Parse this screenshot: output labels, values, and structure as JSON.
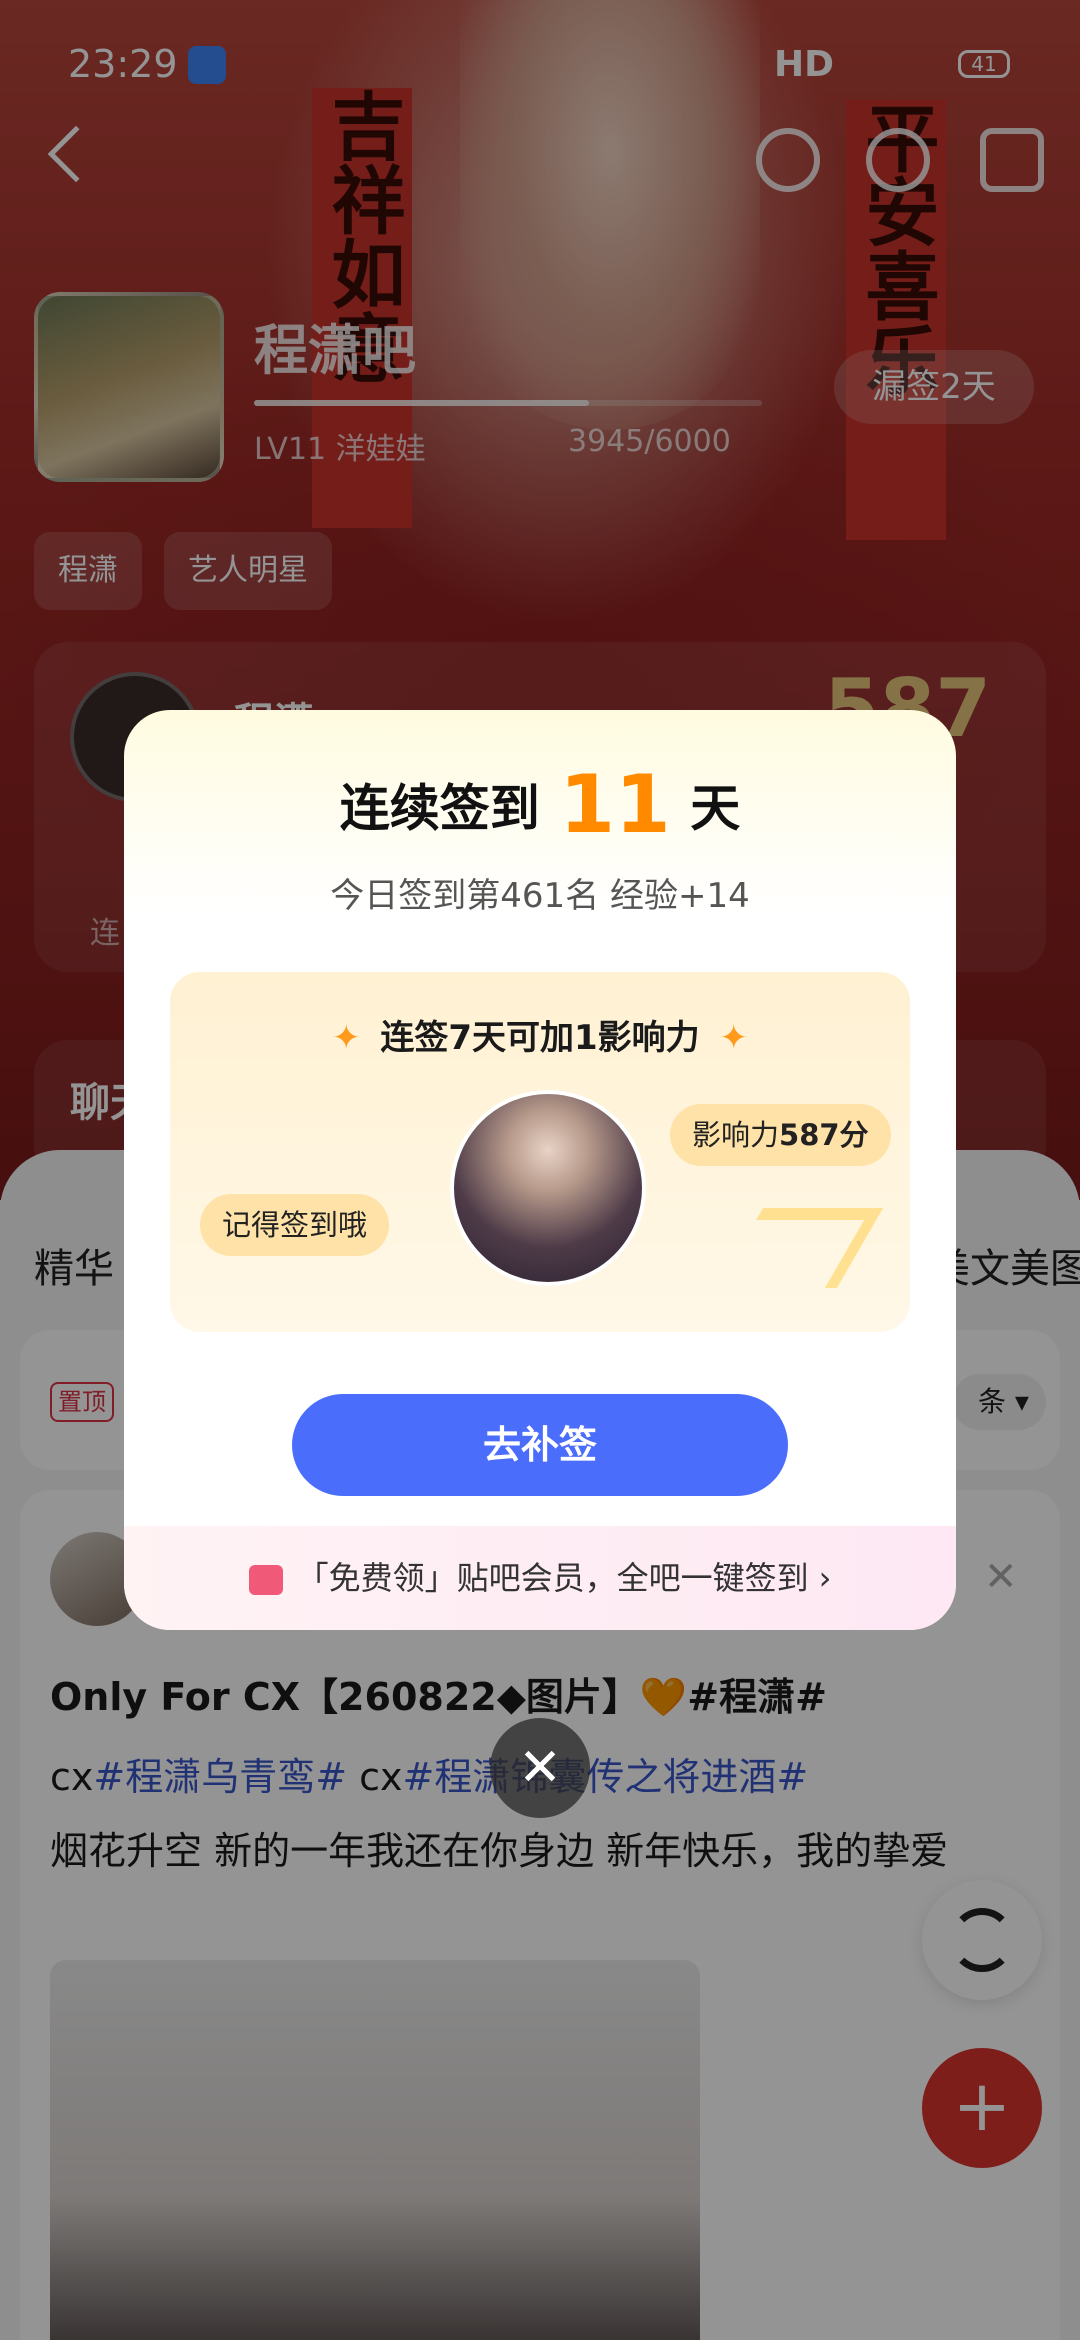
{
  "status_bar": {
    "time": "23:29",
    "network": "HD",
    "battery": "41"
  },
  "forum": {
    "name": "程潇吧",
    "level": "LV11 洋娃娃",
    "exp": "3945/6000",
    "missed_button": "漏签2天",
    "tags": [
      "程潇",
      "艺人明星"
    ],
    "banner_left": "吉祥如意",
    "banner_right": "平安喜乐"
  },
  "rank_card": {
    "name": "程潇",
    "score": "587",
    "label_line": "连",
    "chat_label": "聊天"
  },
  "tabs": {
    "left": "精华",
    "right": "美文美图"
  },
  "pinned": {
    "badge": "置顶",
    "dropdown": "条"
  },
  "post": {
    "title": "Only For CX【260822◆图片】🧡#程潇#",
    "line1_a": "cx",
    "line1_tag1": "#程潇乌青鸾#",
    "line1_b": " cx",
    "line1_tag2": "#程潇锦囊传之将进酒#",
    "body": "烟花升空 新的一年我还在你身边 新年快乐，我的挚爱"
  },
  "modal": {
    "title_prefix": "连续签到",
    "days": "11",
    "title_suffix": "天",
    "subtitle": "今日签到第461名 经验+14",
    "promo_title": "连签7天可加1影响力",
    "bubble_left": "记得签到哦",
    "bubble_right_label": "影响力",
    "bubble_right_value": "587分",
    "cta": "去补签",
    "footer": "「免费领」贴吧会员，全吧一键签到"
  },
  "colors": {
    "accent_orange": "#ff8a00",
    "cta_blue": "#4a6dfb",
    "fab_red": "#d8342f"
  }
}
